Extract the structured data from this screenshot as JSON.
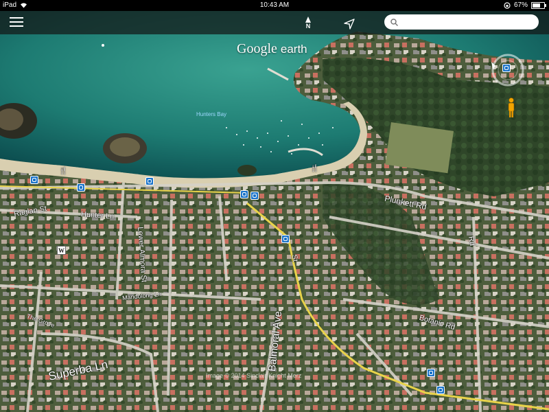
{
  "status_bar": {
    "device": "iPad",
    "time": "10:43 AM",
    "battery": "67%",
    "battery_level": 0.67
  },
  "toolbar": {
    "compass_label": "N",
    "search_placeholder": ""
  },
  "map": {
    "logo_google": "Google",
    "logo_earth": "earth",
    "bay_label": "Hunters Bay",
    "streets": [
      "Raglan St",
      "Hunter Ln",
      "Lower Almora St",
      "Plunkett Rd",
      "Rd",
      "Mandolong Ln",
      "Botanic Rd",
      "Balmoral Ave",
      "Superba Ln",
      "St",
      "The Grove"
    ],
    "credit": "Image © 2014 Sinclair Knight Merz"
  },
  "colors": {
    "water_deep": "#0e5a5a",
    "water_shallow": "#2f9a8a",
    "sand": "#d9cfb0",
    "poi_blue": "#1a73c9",
    "road_yellow": "#e8d34a"
  }
}
